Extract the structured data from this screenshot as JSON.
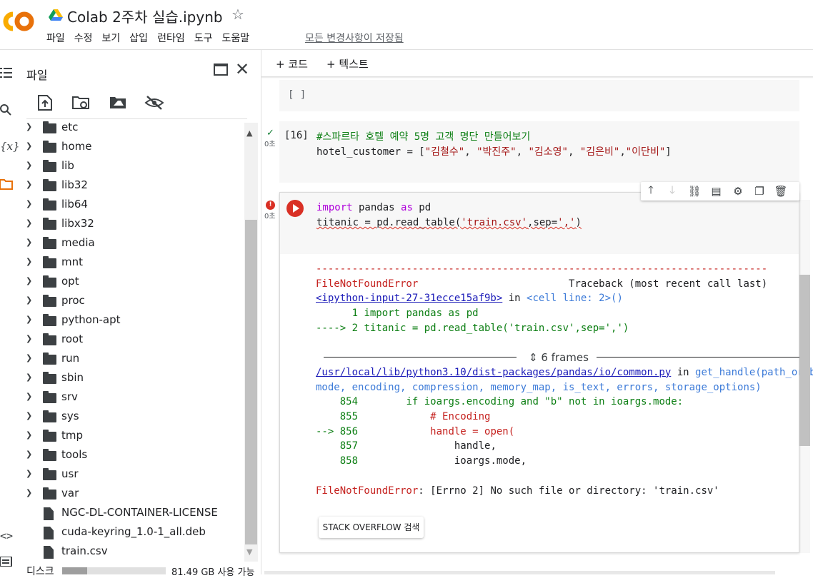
{
  "app": {
    "logo": "CO",
    "title": "Colab 2주차 실습.ipynb",
    "star_icon": "star-outline-icon",
    "menu": [
      "파일",
      "수정",
      "보기",
      "삽입",
      "런타임",
      "도구",
      "도움말"
    ],
    "save_status": "모든 변경사항이 저장됨"
  },
  "side_panel": {
    "title": "파일",
    "tree": [
      {
        "name": "etc",
        "type": "folder"
      },
      {
        "name": "home",
        "type": "folder"
      },
      {
        "name": "lib",
        "type": "folder"
      },
      {
        "name": "lib32",
        "type": "folder"
      },
      {
        "name": "lib64",
        "type": "folder"
      },
      {
        "name": "libx32",
        "type": "folder"
      },
      {
        "name": "media",
        "type": "folder"
      },
      {
        "name": "mnt",
        "type": "folder"
      },
      {
        "name": "opt",
        "type": "folder"
      },
      {
        "name": "proc",
        "type": "folder"
      },
      {
        "name": "python-apt",
        "type": "folder"
      },
      {
        "name": "root",
        "type": "folder"
      },
      {
        "name": "run",
        "type": "folder"
      },
      {
        "name": "sbin",
        "type": "folder"
      },
      {
        "name": "srv",
        "type": "folder"
      },
      {
        "name": "sys",
        "type": "folder"
      },
      {
        "name": "tmp",
        "type": "folder"
      },
      {
        "name": "tools",
        "type": "folder"
      },
      {
        "name": "usr",
        "type": "folder"
      },
      {
        "name": "var",
        "type": "folder"
      },
      {
        "name": "NGC-DL-CONTAINER-LICENSE",
        "type": "file"
      },
      {
        "name": "cuda-keyring_1.0-1_all.deb",
        "type": "file"
      },
      {
        "name": "train.csv",
        "type": "file"
      }
    ],
    "disk_label": "디스크",
    "disk_text": "81.49 GB 사용 가능",
    "disk_used_fraction": 0.24
  },
  "toolbar": {
    "add_code": "+ 코드",
    "add_text": "+ 텍스트"
  },
  "cells": {
    "empty_label": "[ ]",
    "cell16": {
      "exec_count": "[16]",
      "time": "0초",
      "line1": "#스파르타 호텔 예약 5명 고객 명단 만들어보기",
      "line2_var": "hotel_customer",
      "line2_eq": " = [",
      "s1": "\"김철수\"",
      "s2": "\"박진주\"",
      "s3": "\"김소영\"",
      "s4": "\"김은비\"",
      "s5": "\"이단비\"",
      "sep": ", ",
      "line2_end": "]"
    },
    "err_cell": {
      "time": "0초",
      "kw_import": "import",
      "mod": " pandas ",
      "kw_as": "as",
      "alias": " pd",
      "l2_a": "titanic = pd.read_table(",
      "l2_s1": "'train.csv'",
      "l2_b": ",sep=",
      "l2_s2": "','",
      "l2_c": ")"
    }
  },
  "output": {
    "dashes": "---------------------------------------------------------------------------",
    "err_name": "FileNotFoundError",
    "traceback": "                         Traceback (most recent call last)",
    "input_link": "<ipython-input-27-31ecce15af9b>",
    "in_word": " in ",
    "cell_line": "<cell line: 2>()",
    "l1_num": "      1 ",
    "l1_code": "import pandas as pd",
    "l2_arrow": "----> 2 ",
    "l2_code": "titanic = pd.read_table('train.csv',sep=',')",
    "frames": "6 frames",
    "path_link": "/usr/local/lib/python3.10/dist-packages/pandas/io/common.py",
    "path_in": " in ",
    "func": "get_handle(path_or_buf,",
    "args_line": "mode, encoding, compression, memory_map, is_text, errors, storage_options)",
    "t854_num": "    854 ",
    "t854_code": "       if ioargs.encoding and \"b\" not in ioargs.mode:",
    "t855_num": "    855 ",
    "t855_code": "           # Encoding",
    "t856_num": "--> 856 ",
    "t856_code": "           handle = open(",
    "t857_num": "    857 ",
    "t857_code": "               handle,",
    "t858_num": "    858 ",
    "t858_code": "               ioargs.mode,",
    "final_name": "FileNotFoundError",
    "final_msg": ": [Errno 2] No such file or directory: 'train.csv'",
    "so_button": "STACK OVERFLOW 검색"
  }
}
